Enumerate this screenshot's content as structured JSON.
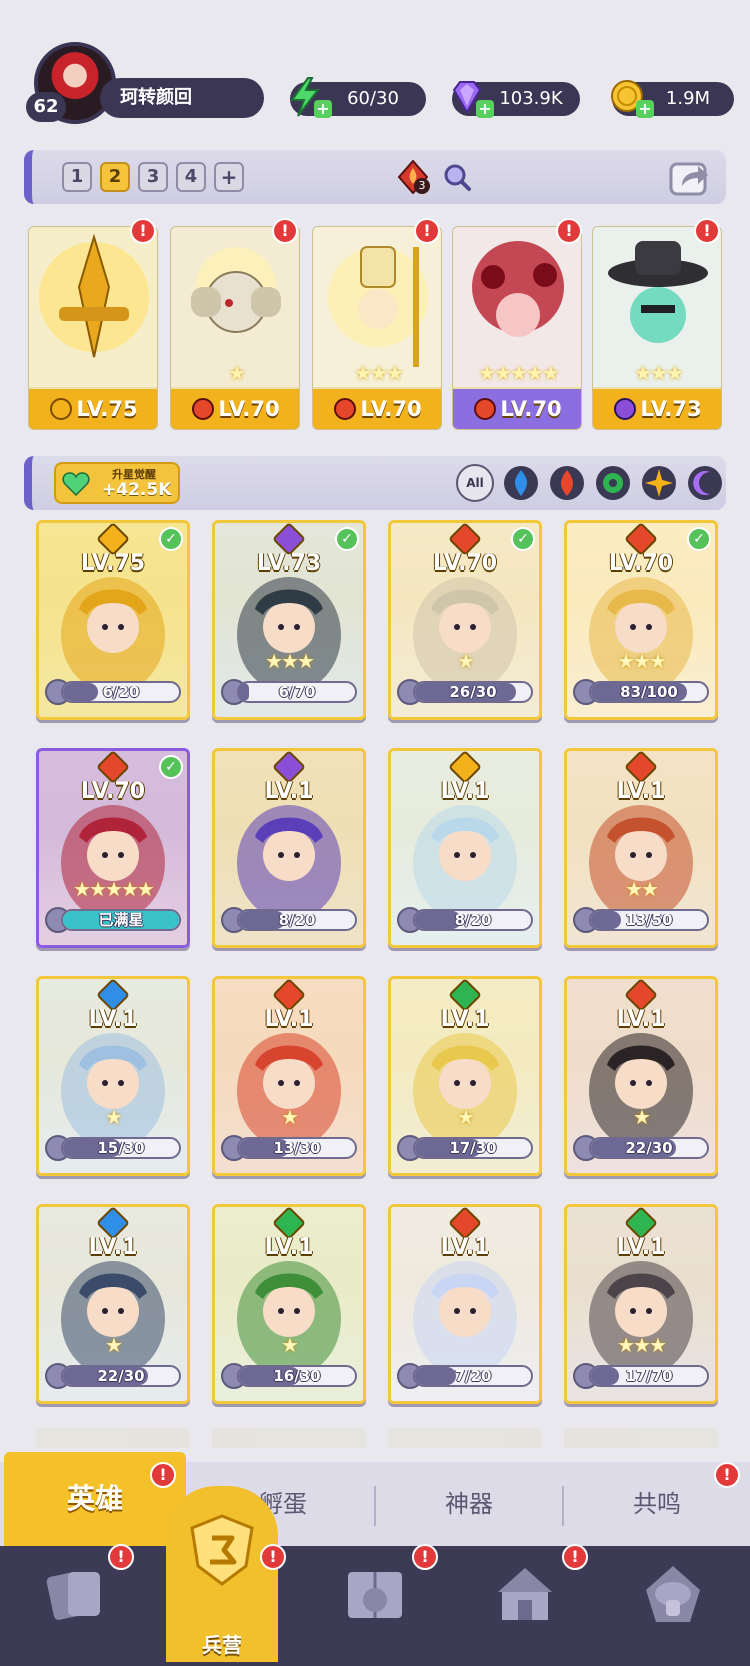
{
  "player": {
    "level": "62",
    "name": "珂转颜回"
  },
  "resources": {
    "energy": "60/30",
    "gems": "103.9K",
    "gold": "1.9M"
  },
  "team_tabs": [
    "1",
    "2",
    "3",
    "4",
    "+"
  ],
  "team_tab_active": "2",
  "diamond_badge": "3",
  "team": [
    {
      "level": "LV.75",
      "element": "light",
      "stars": 0
    },
    {
      "level": "LV.70",
      "element": "fire",
      "stars": 1
    },
    {
      "level": "LV.70",
      "element": "fire",
      "stars": 3
    },
    {
      "level": "LV.70",
      "element": "fire",
      "stars": 5
    },
    {
      "level": "LV.73",
      "element": "dark",
      "stars": 3
    }
  ],
  "awaken": {
    "title": "升星觉醒",
    "value": "+42.5K"
  },
  "filters": {
    "all_label": "All",
    "elements": [
      "water",
      "fire",
      "wind",
      "light",
      "dark"
    ]
  },
  "heroes": [
    {
      "level": "LV.75",
      "element": "light",
      "stars": 0,
      "progress": "6/20",
      "fraction": 0.3,
      "owned": true,
      "card": "gold"
    },
    {
      "level": "LV.73",
      "element": "dark",
      "stars": 3,
      "progress": "6/70",
      "fraction": 0.09,
      "owned": true,
      "card": "gold"
    },
    {
      "level": "LV.70",
      "element": "fire",
      "stars": 1,
      "progress": "26/30",
      "fraction": 0.87,
      "owned": true,
      "card": "gold"
    },
    {
      "level": "LV.70",
      "element": "fire",
      "stars": 3,
      "progress": "83/100",
      "fraction": 0.83,
      "owned": true,
      "card": "gold"
    },
    {
      "level": "LV.70",
      "element": "fire",
      "stars": 5,
      "progress": "已满星",
      "fraction": 1.0,
      "owned": true,
      "card": "purple"
    },
    {
      "level": "LV.1",
      "element": "dark",
      "stars": 0,
      "progress": "8/20",
      "fraction": 0.4,
      "owned": false,
      "card": "gold"
    },
    {
      "level": "LV.1",
      "element": "light",
      "stars": 0,
      "progress": "8/20",
      "fraction": 0.4,
      "owned": false,
      "card": "gold"
    },
    {
      "level": "LV.1",
      "element": "fire",
      "stars": 2,
      "progress": "13/50",
      "fraction": 0.26,
      "owned": false,
      "card": "gold"
    },
    {
      "level": "LV.1",
      "element": "water",
      "stars": 1,
      "progress": "15/30",
      "fraction": 0.5,
      "owned": false,
      "card": "gold"
    },
    {
      "level": "LV.1",
      "element": "fire",
      "stars": 1,
      "progress": "13/30",
      "fraction": 0.43,
      "owned": false,
      "card": "gold"
    },
    {
      "level": "LV.1",
      "element": "wind",
      "stars": 1,
      "progress": "17/30",
      "fraction": 0.57,
      "owned": false,
      "card": "gold"
    },
    {
      "level": "LV.1",
      "element": "fire",
      "stars": 1,
      "progress": "22/30",
      "fraction": 0.73,
      "owned": false,
      "card": "gold"
    },
    {
      "level": "LV.1",
      "element": "water",
      "stars": 1,
      "progress": "22/30",
      "fraction": 0.73,
      "owned": false,
      "card": "gold"
    },
    {
      "level": "LV.1",
      "element": "wind",
      "stars": 1,
      "progress": "16/30",
      "fraction": 0.53,
      "owned": false,
      "card": "gold"
    },
    {
      "level": "LV.1",
      "element": "fire",
      "stars": 0,
      "progress": "7/20",
      "fraction": 0.35,
      "owned": false,
      "card": "gold"
    },
    {
      "level": "LV.1",
      "element": "wind",
      "stars": 3,
      "progress": "17/70",
      "fraction": 0.24,
      "owned": false,
      "card": "gold"
    }
  ],
  "subtabs": [
    "英雄",
    "孵蛋",
    "神器",
    "共鸣"
  ],
  "nav": {
    "active_label": "兵营"
  },
  "colors": {
    "accent_gold": "#f4c12b",
    "panel_dark": "#3b3653",
    "alert_red": "#e23a3a",
    "element_fire": "#e5472b",
    "element_water": "#2f8ee8",
    "element_wind": "#2eb552",
    "element_light": "#f3b21b",
    "element_dark": "#8a4fd6"
  }
}
